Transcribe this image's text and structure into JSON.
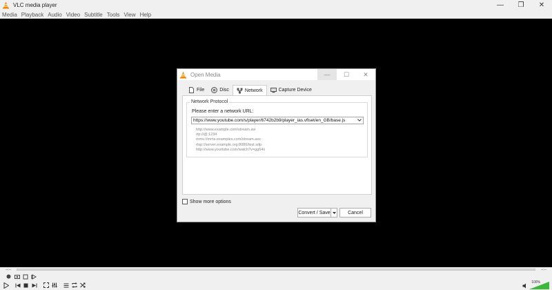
{
  "window": {
    "title": "VLC media player",
    "minimize": "—",
    "maximize": "❐",
    "close": "✕"
  },
  "menu": [
    "Media",
    "Playback",
    "Audio",
    "Video",
    "Subtitle",
    "Tools",
    "View",
    "Help"
  ],
  "seek": {
    "elapsed": "--:--",
    "remaining": "--:--"
  },
  "volume": {
    "label": "100%",
    "level": 1.0
  },
  "dialog": {
    "title": "Open Media",
    "minimize": "—",
    "maximize": "☐",
    "close": "✕",
    "tabs": [
      {
        "label": "File",
        "icon": "file-icon"
      },
      {
        "label": "Disc",
        "icon": "disc-icon"
      },
      {
        "label": "Network",
        "icon": "network-icon",
        "active": true
      },
      {
        "label": "Capture Device",
        "icon": "capture-device-icon"
      }
    ],
    "group_title": "Network Protocol",
    "url_label": "Please enter a network URL:",
    "url_value": "https://www.youtube.com/s/player/6742b2b9/player_ias.vflset/en_GB/base.js",
    "examples": [
      "http://www.example.com/stream.avi",
      "rtp://@:1234",
      "mms://mms.examples.com/stream.asx",
      "rtsp://server.example.org:8080/test.sdp",
      "http://www.yourtube.com/watch?v=gg64x"
    ],
    "show_more_options": "Show more options",
    "convert_save": "Convert / Save",
    "cancel": "Cancel"
  },
  "colors": {
    "vlc_orange": "#f08a00",
    "video_bg": "#000000",
    "volume_green": "#3cb83c"
  }
}
